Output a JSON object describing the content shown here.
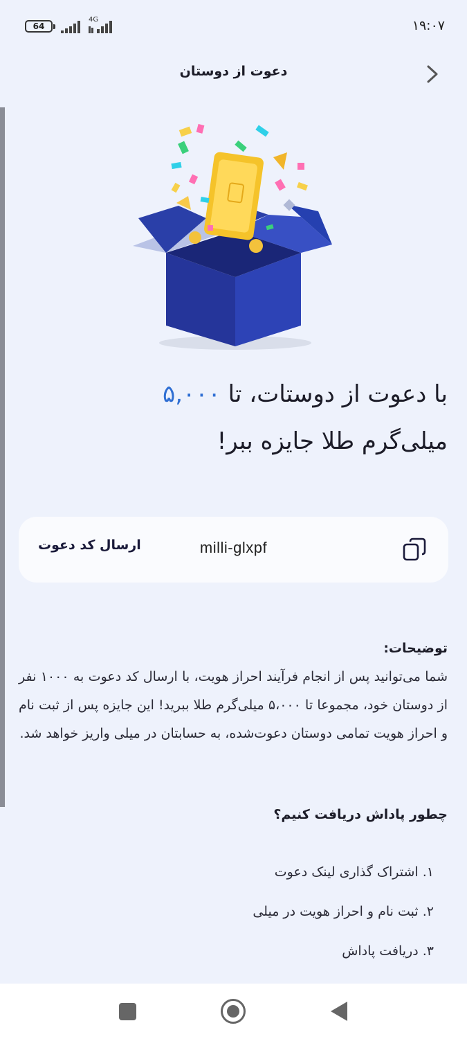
{
  "status_bar": {
    "time": "۱۹:۰۷",
    "battery": "64",
    "network": "4G"
  },
  "header": {
    "title": "دعوت از دوستان"
  },
  "headline": {
    "part1": "با دعوت از دوستات، تا ",
    "amount": "۵,۰۰۰",
    "part2": "میلی‌گرم طلا جایزه ببر!"
  },
  "invite": {
    "code": "milli-glxpf",
    "send_label": "ارسال کد دعوت"
  },
  "description": {
    "title": "توضیحات:",
    "body": "شما می‌توانید پس از انجام فرآیند احراز هویت، با ارسال کد دعوت به ۱۰۰۰ نفر از دوستان خود، مجموعا تا ۵،۰۰۰ میلی‌گرم طلا ببرید! این جایزه پس از ثبت نام و احراز هویت تمامی دوستان دعوت‌شده، به حسابتان در میلی واریز خواهد شد."
  },
  "how": {
    "title": "چطور پاداش دریافت کنیم؟",
    "steps": [
      "۱. اشتراک گذاری لینک دعوت",
      "۲. ثبت نام و احراز هویت در میلی",
      "۳. دریافت پاداش"
    ]
  },
  "colors": {
    "background": "#eef2fc",
    "accent": "#2f6fd3",
    "card": "#fafbfe"
  },
  "icons": {
    "back": "chevron-right-icon",
    "copy": "copy-icon"
  }
}
